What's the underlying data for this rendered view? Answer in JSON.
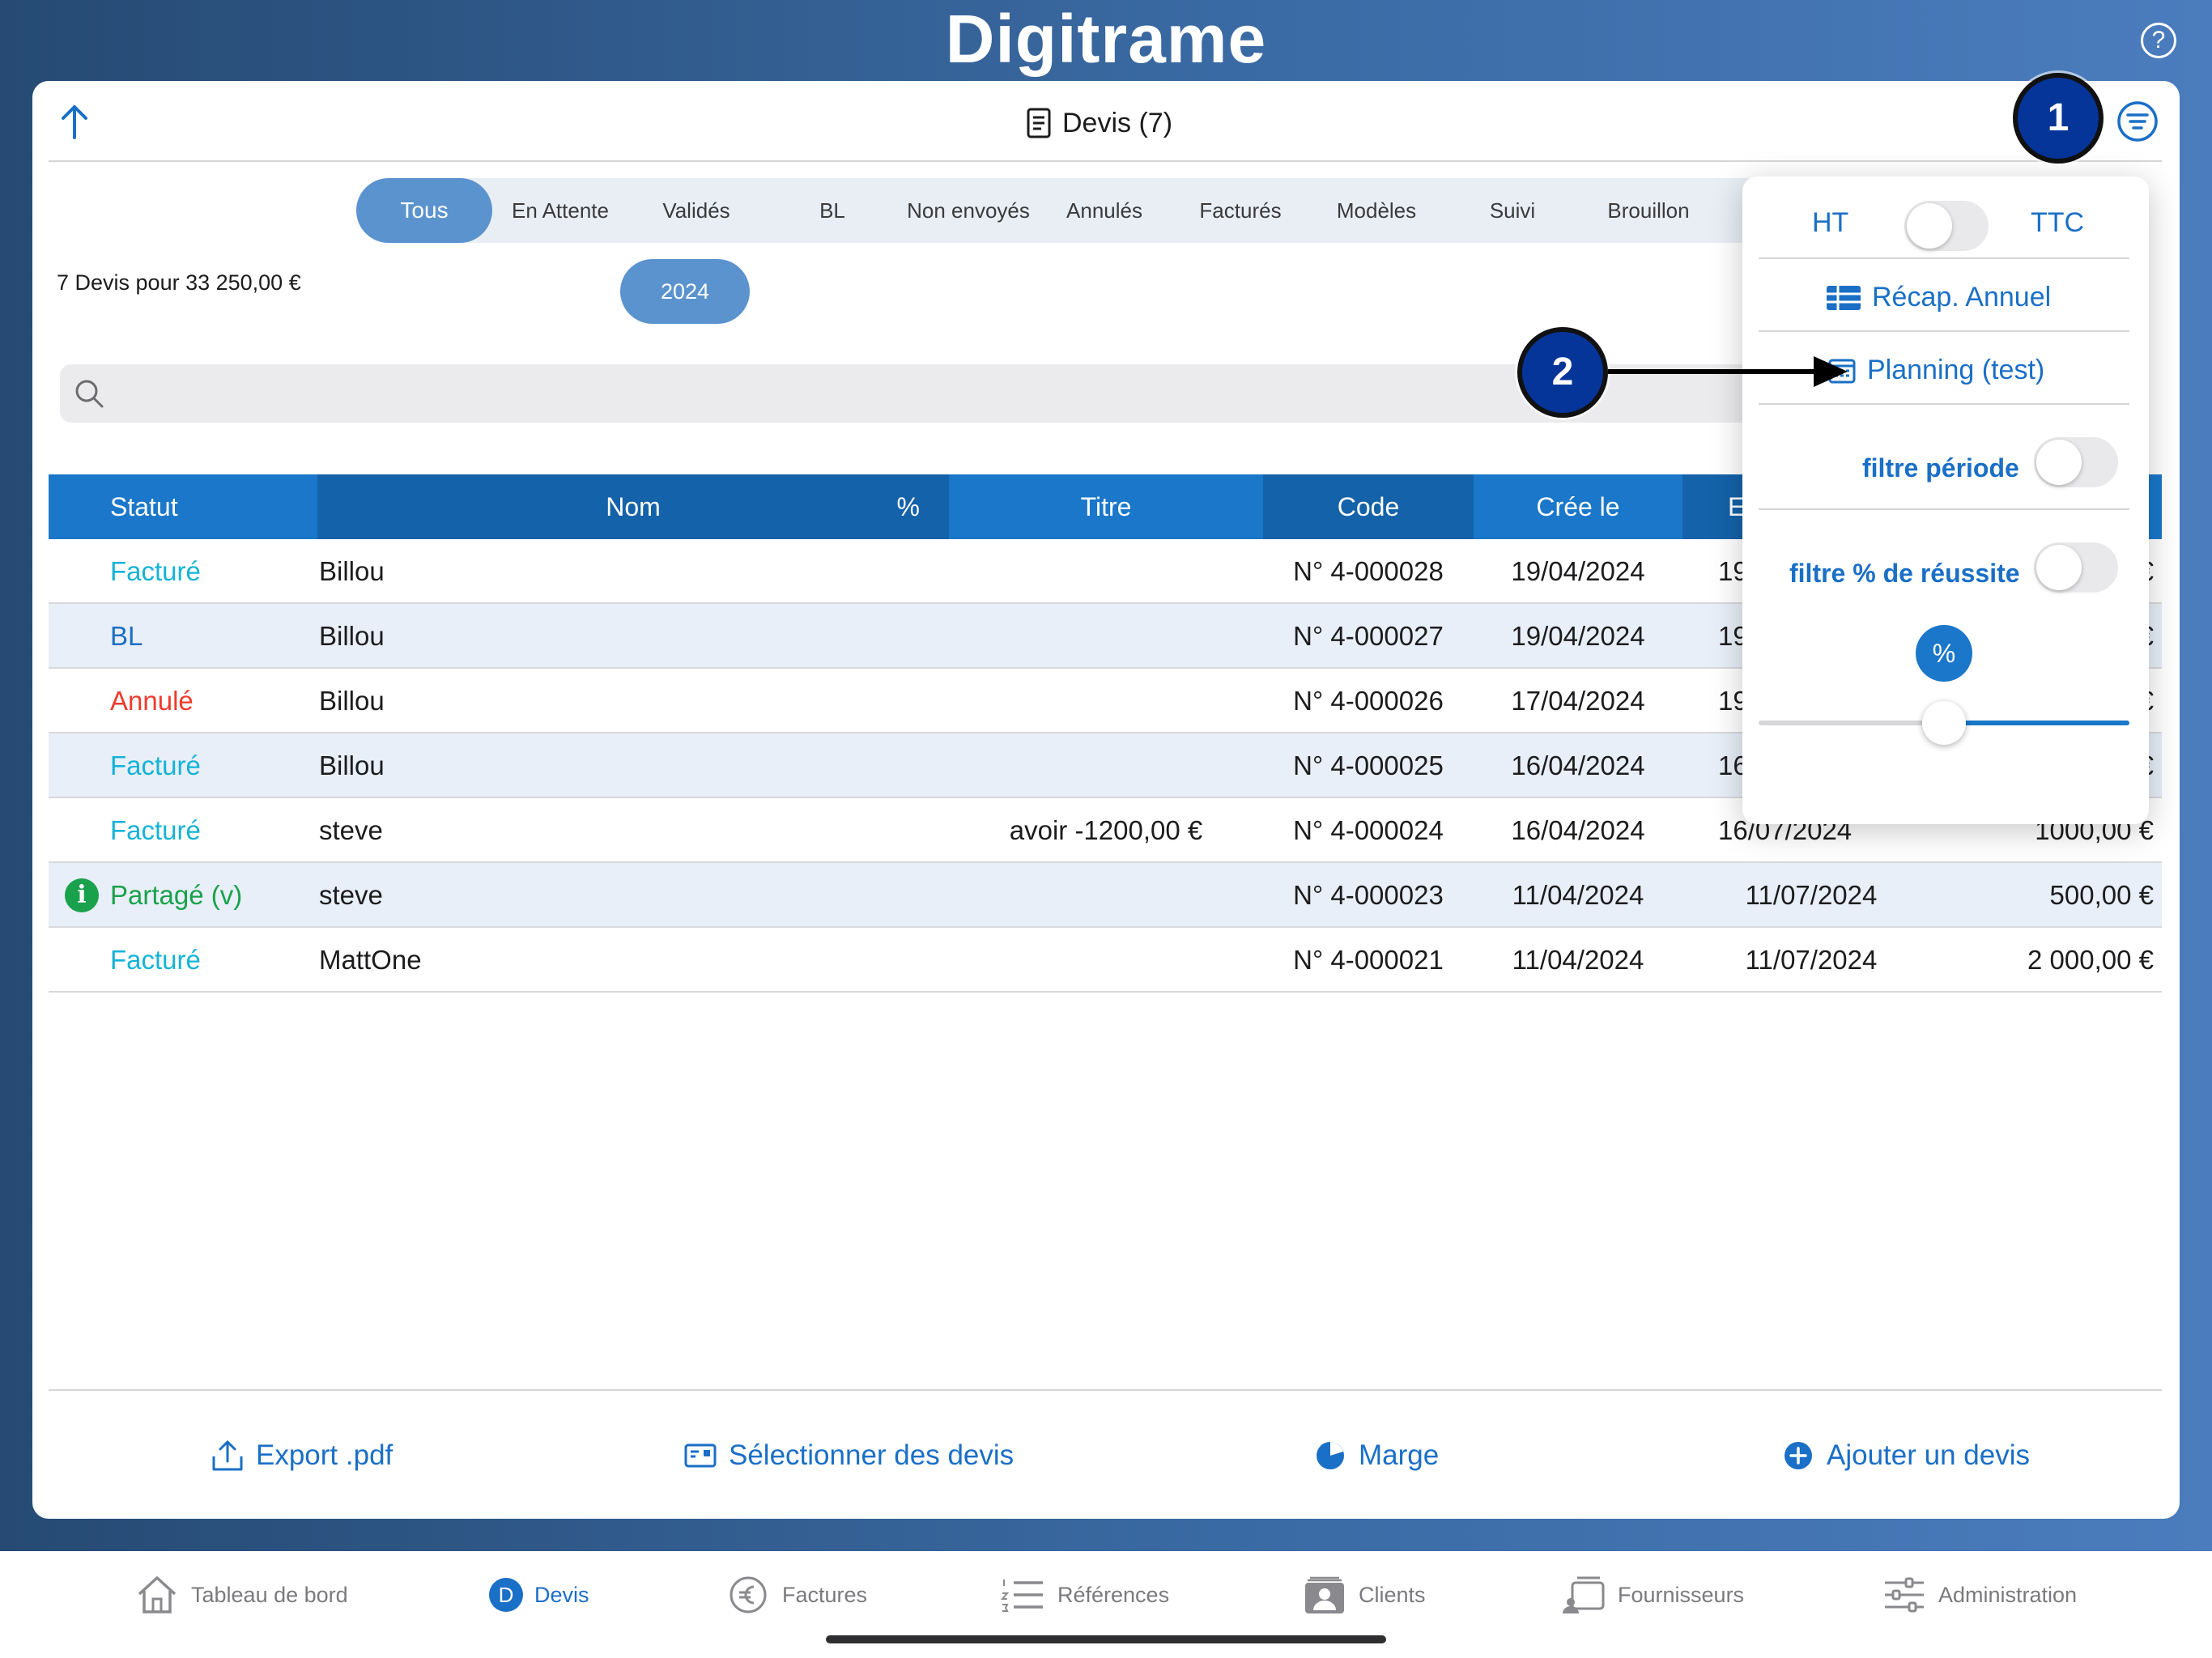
{
  "header": {
    "logo_text": "Digitrame",
    "help_label": "?"
  },
  "toolbar": {
    "title": "Devis (7)",
    "callout_1": "1",
    "callout_2": "2"
  },
  "tabs": [
    {
      "label": "Tous",
      "active": true
    },
    {
      "label": "En Attente"
    },
    {
      "label": "Validés"
    },
    {
      "label": "BL"
    },
    {
      "label": "Non envoyés"
    },
    {
      "label": "Annulés"
    },
    {
      "label": "Facturés"
    },
    {
      "label": "Modèles"
    },
    {
      "label": "Suivi"
    },
    {
      "label": "Brouillon"
    }
  ],
  "summary": "7 Devis pour 33 250,00 €",
  "year_filter": "2024",
  "search": {
    "placeholder": ""
  },
  "table": {
    "columns": [
      "Statut",
      "Nom",
      "%",
      "Titre",
      "Code",
      "Crée le",
      "E"
    ],
    "rows": [
      {
        "status": "Facturé",
        "status_kind": "facture",
        "nom": "Billou",
        "titre": "",
        "code": "N° 4-000028",
        "cree": "19/04/2024",
        "echeance": "19",
        "montant": "€"
      },
      {
        "status": "BL",
        "status_kind": "bl",
        "nom": "Billou",
        "titre": "",
        "code": "N° 4-000027",
        "cree": "19/04/2024",
        "echeance": "19",
        "montant": "€"
      },
      {
        "status": "Annulé",
        "status_kind": "annule",
        "nom": "Billou",
        "titre": "",
        "code": "N° 4-000026",
        "cree": "17/04/2024",
        "echeance": "19",
        "montant": "€"
      },
      {
        "status": "Facturé",
        "status_kind": "facture",
        "nom": "Billou",
        "titre": "",
        "code": "N° 4-000025",
        "cree": "16/04/2024",
        "echeance": "16",
        "montant": "€"
      },
      {
        "status": "Facturé",
        "status_kind": "facture",
        "nom": "steve",
        "titre": "avoir -1200,00 €",
        "code": "N° 4-000024",
        "cree": "16/04/2024",
        "echeance": "16/07/2024",
        "montant": "1000,00 €"
      },
      {
        "status": "Partagé (v)",
        "status_kind": "partage",
        "nom": "steve",
        "titre": "",
        "code": "N° 4-000023",
        "cree": "11/04/2024",
        "echeance": "11/07/2024",
        "montant": "500,00 €",
        "info": "i"
      },
      {
        "status": "Facturé",
        "status_kind": "facture",
        "nom": "MattOne",
        "titre": "",
        "code": "N° 4-000021",
        "cree": "11/04/2024",
        "echeance": "11/07/2024",
        "montant": "2 000,00 €"
      }
    ]
  },
  "actions": {
    "export": "Export .pdf",
    "select": "Sélectionner des devis",
    "marge": "Marge",
    "add": "Ajouter un devis"
  },
  "popover": {
    "ht": "HT",
    "ttc": "TTC",
    "recap": "Récap. Annuel",
    "planning": "Planning (test)",
    "filtre_periode": "filtre période",
    "filtre_reussite": "filtre % de réussite",
    "pct_label": "%",
    "slider_value_fraction": 0.5
  },
  "tabbar": [
    {
      "label": "Tableau de bord",
      "icon": "home-icon"
    },
    {
      "label": "Devis",
      "icon": "d-badge-icon",
      "active": true,
      "badge": "D"
    },
    {
      "label": "Factures",
      "icon": "euro-icon"
    },
    {
      "label": "Références",
      "icon": "numbered-list-icon"
    },
    {
      "label": "Clients",
      "icon": "client-card-icon"
    },
    {
      "label": "Fournisseurs",
      "icon": "supplier-icon"
    },
    {
      "label": "Administration",
      "icon": "sliders-icon"
    }
  ],
  "colors": {
    "accent": "#1a6fc6",
    "header_blue": "#1a77c9",
    "facture": "#15b3d6",
    "annule": "#ef3b2d",
    "partage": "#1aa14c",
    "callout": "#063599"
  }
}
